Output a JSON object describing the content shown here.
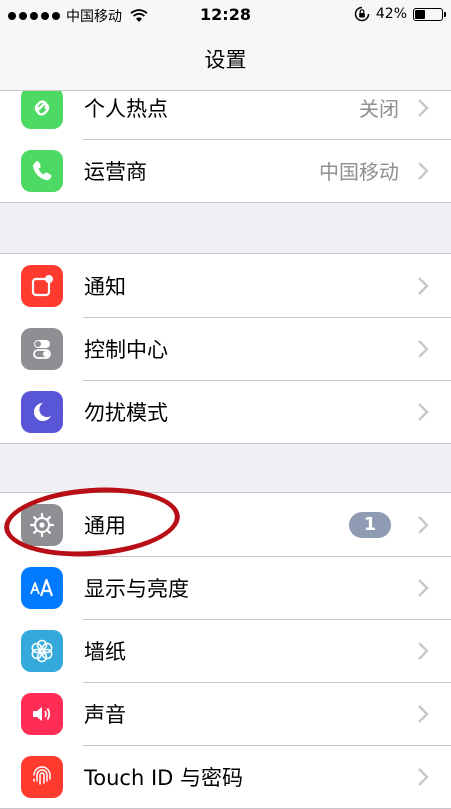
{
  "status_bar": {
    "carrier": "中国移动",
    "time": "12:28",
    "battery_percent": "42%",
    "battery_level": 0.42
  },
  "navbar": {
    "title": "设置"
  },
  "groups": [
    {
      "items": [
        {
          "label": "个人热点",
          "value": "关闭",
          "icon": "hotspot-icon",
          "color": "#4cd964"
        },
        {
          "label": "运营商",
          "value": "中国移动",
          "icon": "phone-icon",
          "color": "#4cd964"
        }
      ]
    },
    {
      "items": [
        {
          "label": "通知",
          "icon": "notifications-icon",
          "color": "#ff3b30"
        },
        {
          "label": "控制中心",
          "icon": "control-center-icon",
          "color": "#8e8e93"
        },
        {
          "label": "勿扰模式",
          "icon": "moon-icon",
          "color": "#5856d6"
        }
      ]
    },
    {
      "items": [
        {
          "label": "通用",
          "badge": "1",
          "icon": "gear-icon",
          "color": "#8e8e93"
        },
        {
          "label": "显示与亮度",
          "icon": "text-size-icon",
          "color": "#007aff"
        },
        {
          "label": "墙纸",
          "icon": "flower-icon",
          "color": "#34aadc"
        },
        {
          "label": "声音",
          "icon": "speaker-icon",
          "color": "#ff2d55"
        },
        {
          "label": "Touch ID 与密码",
          "icon": "fingerprint-icon",
          "color": "#ff3b30"
        }
      ]
    }
  ],
  "annotation_color": "#b80f17"
}
